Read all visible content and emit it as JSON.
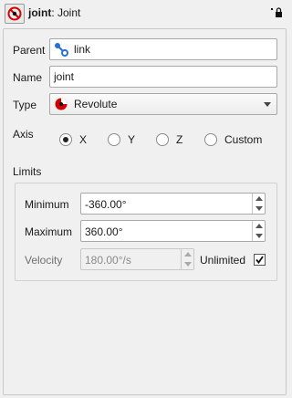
{
  "title": {
    "name": "joint",
    "type": ": Joint"
  },
  "fields": {
    "parent_label": "Parent",
    "parent_value": "link",
    "name_label": "Name",
    "name_value": "joint",
    "type_label": "Type",
    "type_value": "Revolute"
  },
  "axis": {
    "label": "Axis",
    "options": [
      "X",
      "Y",
      "Z",
      "Custom"
    ],
    "selected": "X"
  },
  "limits": {
    "label": "Limits",
    "minimum_label": "Minimum",
    "minimum_value": "-360.00°",
    "maximum_label": "Maximum",
    "maximum_value": "360.00°",
    "velocity_label": "Velocity",
    "velocity_value": "180.00°/s",
    "unlimited_label": "Unlimited",
    "unlimited_checked": true
  },
  "colors": {
    "accent_red": "#d40000",
    "link_blue": "#2a6fd6"
  }
}
